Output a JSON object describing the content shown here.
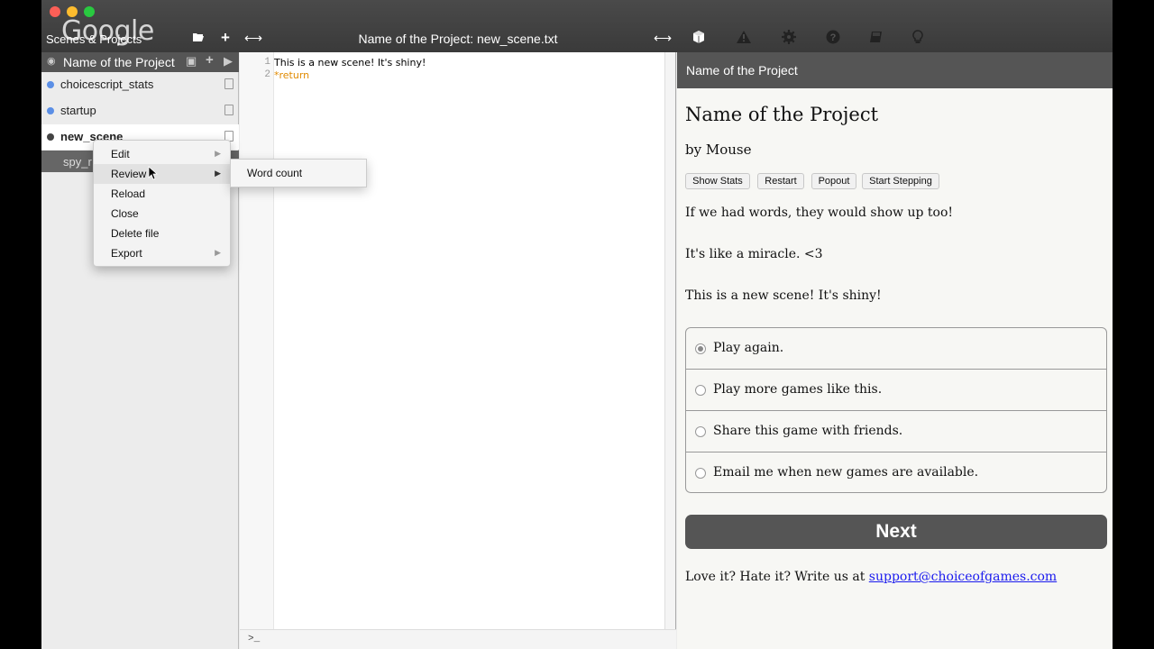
{
  "overlay": {
    "logo_text": "Google"
  },
  "toolbar": {
    "scenes_title": "Scenes & Projects",
    "file_title": "Name of the Project: new_scene.txt",
    "icons": [
      "folder-open-icon",
      "plus-icon",
      "resize-horizontal-icon",
      "resize-horizontal-icon",
      "cube-icon",
      "warning-icon",
      "gear-icon",
      "help-icon",
      "book-icon",
      "lightbulb-icon"
    ]
  },
  "sidebar": {
    "project_name": "Name of the Project",
    "scenes": [
      {
        "label": "choicescript_stats"
      },
      {
        "label": "startup"
      },
      {
        "label": "new_scene"
      },
      {
        "label": "spy_r"
      }
    ]
  },
  "context_menu": {
    "items": [
      {
        "label": "Edit",
        "has_submenu": true
      },
      {
        "label": "Review",
        "has_submenu": true
      },
      {
        "label": "Reload",
        "has_submenu": false
      },
      {
        "label": "Close",
        "has_submenu": false
      },
      {
        "label": "Delete file",
        "has_submenu": false
      },
      {
        "label": "Export",
        "has_submenu": true
      }
    ],
    "submenu_items": [
      {
        "label": "Word count"
      }
    ]
  },
  "editor": {
    "lines": [
      {
        "number": "1",
        "text": "This is a new scene! It's shiny!"
      },
      {
        "number": "2",
        "text": "*return"
      }
    ],
    "console_prompt": ">_"
  },
  "preview": {
    "header": "Name of the Project",
    "title": "Name of the Project",
    "author": "by Mouse",
    "buttons": [
      {
        "label": "Show Stats"
      },
      {
        "label": "Restart"
      },
      {
        "label": "Popout"
      },
      {
        "label": "Start Stepping"
      }
    ],
    "paragraphs": [
      "If we had words, they would show up too!",
      "It's like a miracle. <3",
      "This is a new scene! It's shiny!"
    ],
    "choices": [
      {
        "label": "Play again.",
        "selected": true
      },
      {
        "label": "Play more games like this.",
        "selected": false
      },
      {
        "label": "Share this game with friends.",
        "selected": false
      },
      {
        "label": "Email me when new games are available.",
        "selected": false
      }
    ],
    "next_label": "Next",
    "footer_text": "Love it? Hate it? Write us at ",
    "footer_link": "support@choiceofgames.com"
  },
  "colors": {
    "toolbar_bg": "#3f3f3f",
    "scene_dot": "#5b8fe6",
    "return_keyword": "#e08a00",
    "link": "#1a1aee"
  }
}
